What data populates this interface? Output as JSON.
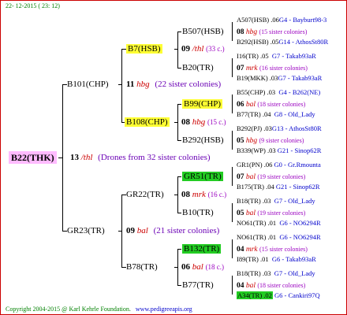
{
  "header": {
    "date": "22- 12-2015 ( 23: 12)"
  },
  "footer": {
    "copyright": "Copyright 2004-2015 @ Karl Kehrle Foundation.",
    "site": "www.pedigreeapis.org"
  },
  "root": {
    "name": "B22(THK)",
    "num": "13",
    "abbr": "/thl",
    "note": "(Drones from 32 sister colonies)"
  },
  "g1": [
    {
      "name": "B101(CHP)",
      "num": "11",
      "abbr": "hbg",
      "note": "(22 sister colonies)"
    },
    {
      "name": "GR23(TR)",
      "num": "09",
      "abbr": "bal",
      "note": "(21 sister colonies)"
    }
  ],
  "g2": [
    {
      "name": "B7(HSB)",
      "num": "09",
      "abbr": "/thl",
      "note": "(33 c.)"
    },
    {
      "name": "B108(CHP)",
      "num": "08",
      "abbr": "hbg",
      "note": "(15 c.)"
    },
    {
      "name": "GR22(TR)",
      "num": "08",
      "abbr": "mrk",
      "note": "(16 c.)"
    },
    {
      "name": "B78(TR)",
      "num": "06",
      "abbr": "bal",
      "note": "(18 c.)"
    }
  ],
  "g3": [
    {
      "name": "B507(HSB)"
    },
    {
      "name": "B20(TR)"
    },
    {
      "name": "B99(CHP)"
    },
    {
      "name": "B292(HSB)"
    },
    {
      "name": "GR51(TR)"
    },
    {
      "name": "B10(TR)"
    },
    {
      "name": "B132(TR)"
    },
    {
      "name": "B77(TR)"
    }
  ],
  "g3drones": [
    {
      "num": "08",
      "abbr": "hbg",
      "note": "(15 sister colonies)"
    },
    {
      "num": "07",
      "abbr": "mrk",
      "note": "(16 sister colonies)"
    },
    {
      "num": "06",
      "abbr": "bal",
      "note": "(18 sister colonies)"
    },
    {
      "num": "05",
      "abbr": "hbg",
      "note": "(9 sister colonies)"
    },
    {
      "num": "07",
      "abbr": "bal",
      "note": "(19 sister colonies)"
    },
    {
      "num": "05",
      "abbr": "bal",
      "note": "(19 sister colonies)"
    },
    {
      "num": "04",
      "abbr": "mrk",
      "note": "(15 sister colonies)"
    },
    {
      "num": "04",
      "abbr": "bal",
      "note": "(18 sister colonies)"
    }
  ],
  "g4": [
    {
      "name": "A507(HSB)",
      "num": ".06",
      "sire": "G4 - Bayburt98-3"
    },
    {
      "name": "B292(HSB)",
      "num": ".05",
      "sire": "G14 - AthosSt80R"
    },
    {
      "name": "I16(TR)",
      "num": ".05",
      "sire": "G7 - Takab93aR"
    },
    {
      "name": "B19(MKK)",
      "num": ".03",
      "sire": "G7 - Takab93aR"
    },
    {
      "name": "B55(CHP)",
      "num": ".03",
      "sire": "G4 - B262(NE)"
    },
    {
      "name": "B77(TR)",
      "num": ".04",
      "sire": "G8 - Old_Lady"
    },
    {
      "name": "B292(PJ)",
      "num": ".03",
      "sire": "G13 - AthosSt80R"
    },
    {
      "name": "B339(WP)",
      "num": ".03",
      "sire": "G21 - Sinop62R"
    },
    {
      "name": "GR1(PN)",
      "num": ".06",
      "sire": "G0 - Gr.Rmounta"
    },
    {
      "name": "B175(TR)",
      "num": ".04",
      "sire": "G21 - Sinop62R"
    },
    {
      "name": "B18(TR)",
      "num": ".03",
      "sire": "G7 - Old_Lady"
    },
    {
      "name": "NO61(TR)",
      "num": ".01",
      "sire": "G6 - NO6294R"
    },
    {
      "name": "NO61(TR)",
      "num": ".01",
      "sire": "G6 - NO6294R"
    },
    {
      "name": "I89(TR)",
      "num": ".01",
      "sire": "G6 - Takab93aR"
    },
    {
      "name": "B18(TR)",
      "num": ".03",
      "sire": "G7 - Old_Lady"
    },
    {
      "name": "A34(TR)",
      "num": ".02",
      "sire": "G6 - Cankiri97Q"
    }
  ]
}
